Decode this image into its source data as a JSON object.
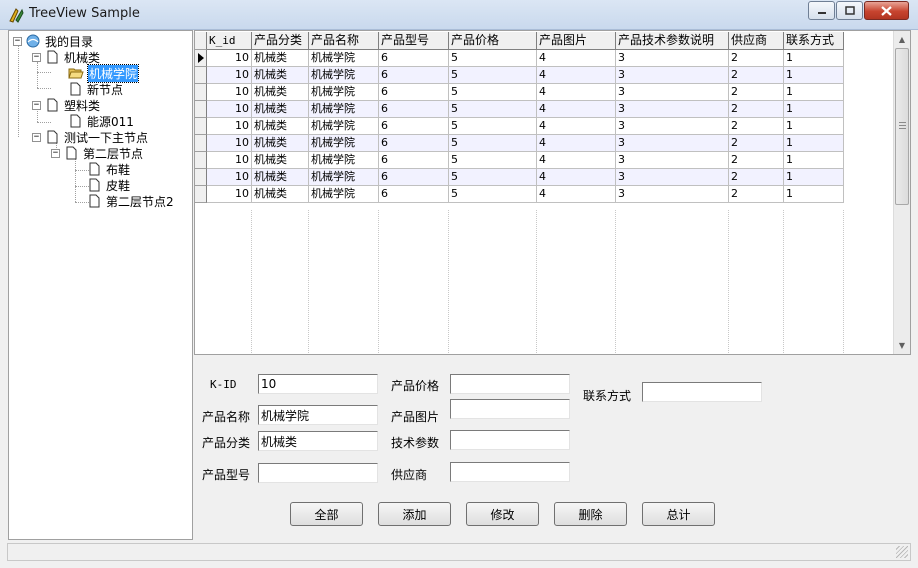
{
  "window": {
    "title": "TreeView Sample"
  },
  "tree": {
    "root": "我的目录",
    "n1": "机械类",
    "n1_1": "机械学院",
    "n1_2": "新节点",
    "n2": "塑料类",
    "n2_1": "能源011",
    "n3": "测试一下主节点",
    "n3_1": "第二层节点",
    "n3_1_1": "布鞋",
    "n3_1_2": "皮鞋",
    "n3_1_3": "第二层节点2"
  },
  "grid": {
    "columns": [
      "K_id",
      "产品分类",
      "产品名称",
      "产品型号",
      "产品价格",
      "产品图片",
      "产品技术参数说明",
      "供应商",
      "联系方式"
    ],
    "rows": [
      [
        "10",
        "机械类",
        "机械学院",
        "6",
        "5",
        "4",
        "3",
        "2",
        "1"
      ],
      [
        "10",
        "机械类",
        "机械学院",
        "6",
        "5",
        "4",
        "3",
        "2",
        "1"
      ],
      [
        "10",
        "机械类",
        "机械学院",
        "6",
        "5",
        "4",
        "3",
        "2",
        "1"
      ],
      [
        "10",
        "机械类",
        "机械学院",
        "6",
        "5",
        "4",
        "3",
        "2",
        "1"
      ],
      [
        "10",
        "机械类",
        "机械学院",
        "6",
        "5",
        "4",
        "3",
        "2",
        "1"
      ],
      [
        "10",
        "机械类",
        "机械学院",
        "6",
        "5",
        "4",
        "3",
        "2",
        "1"
      ],
      [
        "10",
        "机械类",
        "机械学院",
        "6",
        "5",
        "4",
        "3",
        "2",
        "1"
      ],
      [
        "10",
        "机械类",
        "机械学院",
        "6",
        "5",
        "4",
        "3",
        "2",
        "1"
      ],
      [
        "10",
        "机械类",
        "机械学院",
        "6",
        "5",
        "4",
        "3",
        "2",
        "1"
      ]
    ]
  },
  "form": {
    "kid_label": "K-ID",
    "kid_value": "10",
    "name_label": "产品名称",
    "name_value": "机械学院",
    "category_label": "产品分类",
    "category_value": "机械类",
    "model_label": "产品型号",
    "model_value": "",
    "price_label": "产品价格",
    "price_value": "",
    "image_label": "产品图片",
    "image_value": "",
    "tech_label": "技术参数",
    "tech_value": "",
    "supplier_label": "供应商",
    "supplier_value": "",
    "contact_label": "联系方式",
    "contact_value": ""
  },
  "buttons": {
    "all": "全部",
    "add": "添加",
    "edit": "修改",
    "delete": "删除",
    "total": "总计"
  },
  "colors": {
    "selection": "#3399ff",
    "alt_row": "#f2f2ff",
    "close_button": "#c7442f"
  },
  "icons": [
    "app-icon",
    "minimize-icon",
    "maximize-icon",
    "close-icon",
    "folder-root-icon",
    "document-icon",
    "open-folder-icon",
    "current-row-arrow-icon",
    "scroll-up-icon",
    "scroll-down-icon",
    "size-grip-icon"
  ]
}
